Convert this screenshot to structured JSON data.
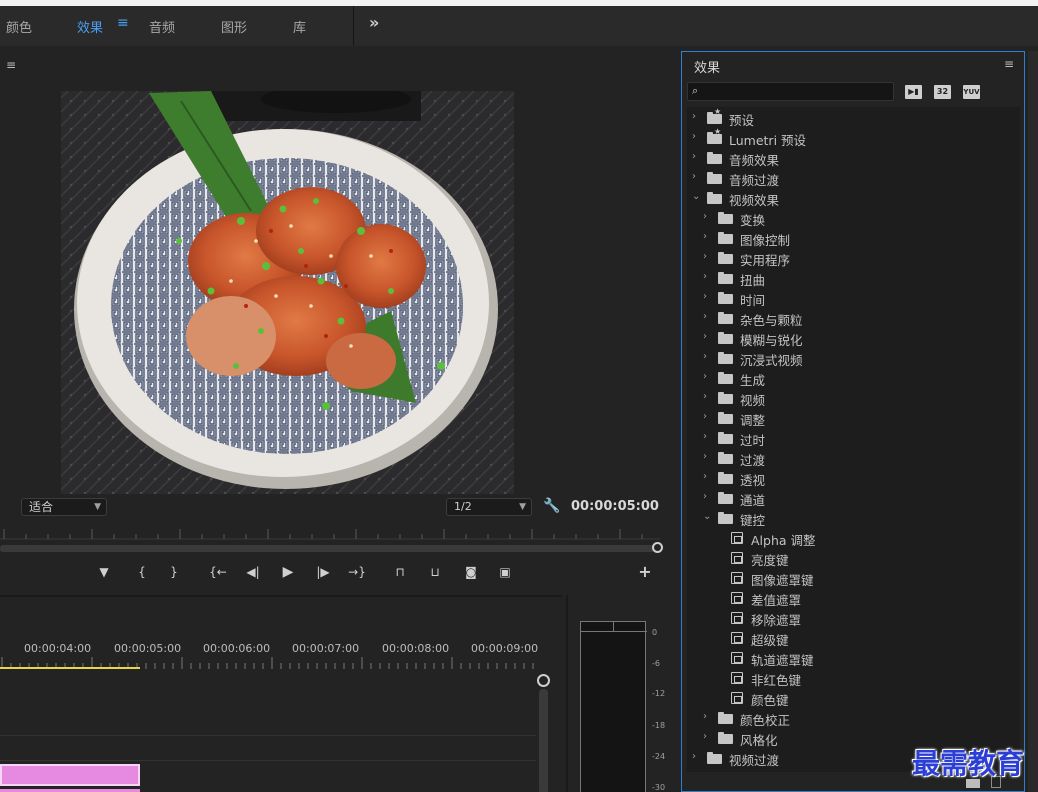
{
  "workspaces": [
    {
      "label": "颜色",
      "active": false
    },
    {
      "label": "效果",
      "active": true
    },
    {
      "label": "音频",
      "active": false
    },
    {
      "label": "图形",
      "active": false
    },
    {
      "label": "库",
      "active": false
    }
  ],
  "workspace_more": "»",
  "monitor": {
    "menu_glyph": "≡",
    "fit": "适合",
    "resolution": "1/2",
    "timecode": "00:00:05:00",
    "image_description_icon": "food-plate-image"
  },
  "timeline": {
    "timecodes": [
      "00:00:04:00",
      "00:00:05:00",
      "00:00:06:00",
      "00:00:07:00",
      "00:00:08:00",
      "00:00:09:00"
    ]
  },
  "meter": {
    "labels": [
      "0",
      "-6",
      "-12",
      "-18",
      "-24",
      "-30"
    ]
  },
  "effects_panel": {
    "title": "效果",
    "menu_glyph": "≡",
    "badges": [
      "32",
      "YUV"
    ],
    "tree": [
      {
        "label": "预设",
        "level": 0,
        "type": "star-folder",
        "expanded": false
      },
      {
        "label": "Lumetri 预设",
        "level": 0,
        "type": "star-folder",
        "expanded": false
      },
      {
        "label": "音频效果",
        "level": 0,
        "type": "folder",
        "expanded": false
      },
      {
        "label": "音频过渡",
        "level": 0,
        "type": "folder",
        "expanded": false
      },
      {
        "label": "视频效果",
        "level": 0,
        "type": "folder",
        "expanded": true
      },
      {
        "label": "变换",
        "level": 1,
        "type": "folder",
        "expanded": false
      },
      {
        "label": "图像控制",
        "level": 1,
        "type": "folder",
        "expanded": false
      },
      {
        "label": "实用程序",
        "level": 1,
        "type": "folder",
        "expanded": false
      },
      {
        "label": "扭曲",
        "level": 1,
        "type": "folder",
        "expanded": false
      },
      {
        "label": "时间",
        "level": 1,
        "type": "folder",
        "expanded": false
      },
      {
        "label": "杂色与颗粒",
        "level": 1,
        "type": "folder",
        "expanded": false
      },
      {
        "label": "模糊与锐化",
        "level": 1,
        "type": "folder",
        "expanded": false
      },
      {
        "label": "沉浸式视频",
        "level": 1,
        "type": "folder",
        "expanded": false
      },
      {
        "label": "生成",
        "level": 1,
        "type": "folder",
        "expanded": false
      },
      {
        "label": "视频",
        "level": 1,
        "type": "folder",
        "expanded": false
      },
      {
        "label": "调整",
        "level": 1,
        "type": "folder",
        "expanded": false
      },
      {
        "label": "过时",
        "level": 1,
        "type": "folder",
        "expanded": false
      },
      {
        "label": "过渡",
        "level": 1,
        "type": "folder",
        "expanded": false
      },
      {
        "label": "透视",
        "level": 1,
        "type": "folder",
        "expanded": false
      },
      {
        "label": "通道",
        "level": 1,
        "type": "folder",
        "expanded": false
      },
      {
        "label": "键控",
        "level": 1,
        "type": "folder",
        "expanded": true
      },
      {
        "label": "Alpha 调整",
        "level": 2,
        "type": "effect"
      },
      {
        "label": "亮度键",
        "level": 2,
        "type": "effect"
      },
      {
        "label": "图像遮罩键",
        "level": 2,
        "type": "effect"
      },
      {
        "label": "差值遮罩",
        "level": 2,
        "type": "effect"
      },
      {
        "label": "移除遮罩",
        "level": 2,
        "type": "effect"
      },
      {
        "label": "超级键",
        "level": 2,
        "type": "effect"
      },
      {
        "label": "轨道遮罩键",
        "level": 2,
        "type": "effect"
      },
      {
        "label": "非红色键",
        "level": 2,
        "type": "effect"
      },
      {
        "label": "颜色键",
        "level": 2,
        "type": "effect"
      },
      {
        "label": "颜色校正",
        "level": 1,
        "type": "folder",
        "expanded": false
      },
      {
        "label": "风格化",
        "level": 1,
        "type": "folder",
        "expanded": false
      },
      {
        "label": "视频过渡",
        "level": 0,
        "type": "folder",
        "expanded": false
      }
    ]
  },
  "watermark": "最需教育",
  "colors": {
    "accent": "#4a9ff0",
    "clip": "#e58ae0",
    "playhead": "#e8d648",
    "panel_border": "#2d7fd0"
  }
}
